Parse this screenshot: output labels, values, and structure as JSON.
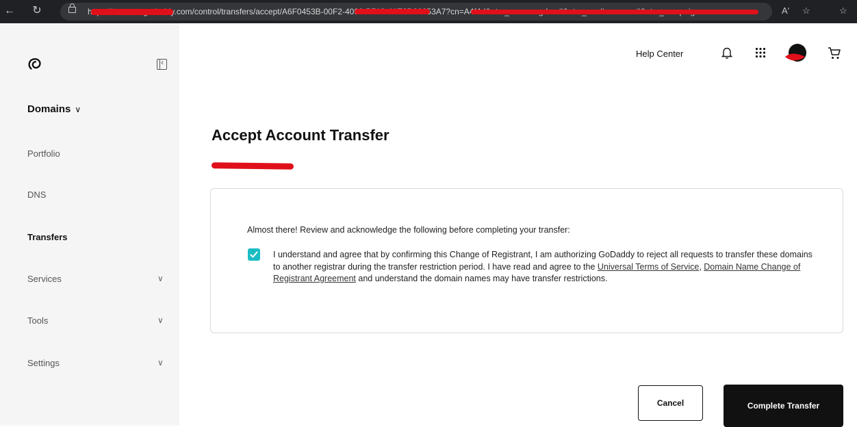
{
  "browser": {
    "back_icon": "arrow-left",
    "reload_icon": "reload",
    "url": "https://account.godaddy.com/control/transfers/accept/A6F0453B-00F2-4000-B519-41E2D80253A7?cn=A4f4d&utm_source=gdmail&utm_medium=email&utm_campaign=en",
    "read_aloud": "Aʹ",
    "favorite_icon": "star",
    "favorites_bar_icon": "favorites"
  },
  "sidebar": {
    "logo_icon": "godaddy-logo",
    "section": "Domains",
    "items": [
      {
        "label": "Portfolio",
        "active": false,
        "expandable": false
      },
      {
        "label": "DNS",
        "active": false,
        "expandable": false
      },
      {
        "label": "Transfers",
        "active": true,
        "expandable": false
      },
      {
        "label": "Services",
        "active": false,
        "expandable": true
      },
      {
        "label": "Tools",
        "active": false,
        "expandable": true
      },
      {
        "label": "Settings",
        "active": false,
        "expandable": true
      }
    ]
  },
  "header": {
    "help_center": "Help Center",
    "icons": [
      "bell-icon",
      "apps-icon",
      "avatar",
      "cart-icon"
    ]
  },
  "main": {
    "title": "Accept Account Transfer",
    "intro": "Almost there! Review and acknowledge the following before completing your transfer:",
    "checkbox_checked": true,
    "agreement_part1": "I understand and agree that by confirming this Change of Registrant, I am authorizing GoDaddy to reject all requests to transfer these domains to another registrar during the transfer restriction period. I have read and agree to the ",
    "link_terms": "Universal Terms of Service",
    "agreement_sep": ", ",
    "link_agreement": "Domain Name Change of Registrant Agreement",
    "agreement_part2": " and understand the domain names may have transfer restrictions.",
    "cancel_label": "Cancel",
    "complete_label": "Complete Transfer"
  },
  "colors": {
    "accent": "#1bbdc3",
    "primary_button": "#111111",
    "sidebar_bg": "#f5f5f5",
    "redaction": "#e0101a"
  }
}
